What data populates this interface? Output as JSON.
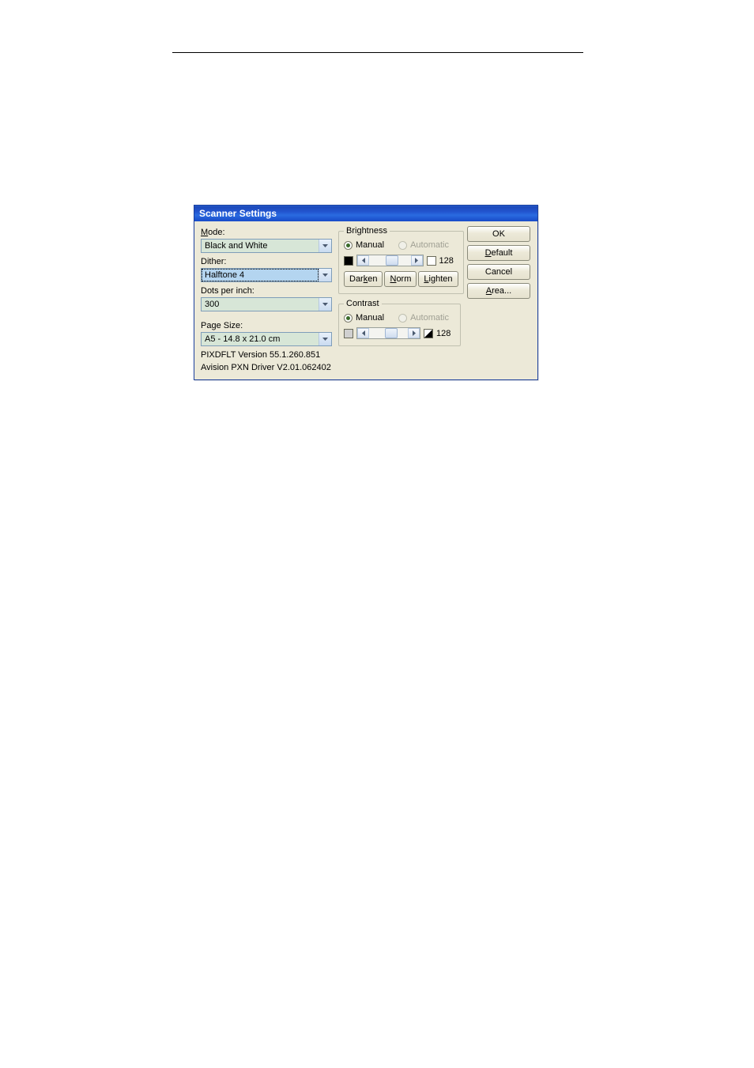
{
  "window": {
    "title": "Scanner Settings"
  },
  "left": {
    "mode_label": "Mode:",
    "mode_value": "Black and White",
    "dither_label": "Dither:",
    "dither_value": "Halftone 4",
    "dpi_label": "Dots per inch:",
    "dpi_value": "300",
    "page_size_label": "Page Size:",
    "page_size_value": "A5 - 14.8 x 21.0 cm",
    "version_line1": "PIXDFLT Version 55.1.260.851",
    "version_line2": "Avision PXN Driver V2.01.062402"
  },
  "brightness": {
    "legend": "Brightness",
    "manual_label": "Manual",
    "automatic_label": "Automatic",
    "value": "128",
    "darken_label": "Darken",
    "norm_label": "Norm",
    "lighten_label": "Lighten"
  },
  "contrast": {
    "legend": "Contrast",
    "manual_label": "Manual",
    "automatic_label": "Automatic",
    "value": "128"
  },
  "buttons": {
    "ok": "OK",
    "default_": "Default",
    "cancel": "Cancel",
    "area": "Area..."
  }
}
